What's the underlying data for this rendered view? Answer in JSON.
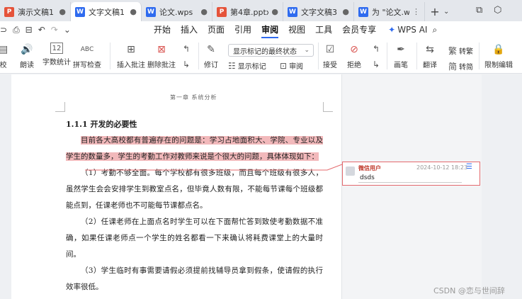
{
  "tabs": [
    {
      "label": "演示文稿1",
      "type": "ppt",
      "type_label": "P",
      "close": "●"
    },
    {
      "label": "文字文稿1",
      "type": "wps",
      "type_label": "W",
      "close": "●",
      "active": true
    },
    {
      "label": "论文.wps",
      "type": "wps",
      "type_label": "W",
      "close": "●"
    },
    {
      "label": "第4章.pptx",
      "type": "ppt",
      "type_label": "P",
      "close": "●"
    },
    {
      "label": "文字文稿3",
      "type": "wps",
      "type_label": "W",
      "close": "●"
    },
    {
      "label": "为 \"论文.wps\"",
      "type": "wps",
      "type_label": "W",
      "close": "⋮"
    }
  ],
  "tabbar": {
    "plus": "+",
    "chevron": "⌄",
    "restore": "⧉",
    "cube": "⬡"
  },
  "quick_access": {
    "link": "⊃",
    "print": "⎙",
    "print_preview": "⊟",
    "undo": "↶",
    "redo": "↷",
    "more": "⌄"
  },
  "menus": [
    "开始",
    "插入",
    "页面",
    "引用",
    "审阅",
    "视图",
    "工具",
    "会员专享"
  ],
  "active_menu": "审阅",
  "wps_ai": {
    "label": "WPS AI",
    "icon": "✦",
    "search": "⌕"
  },
  "ribbon": {
    "proof": "校",
    "read_aloud": "朗读",
    "word_count": "字数统计",
    "word_count_icon": "12",
    "spell_check": "拼写检查",
    "spell_icon": "ABC",
    "insert_comment": "插入批注",
    "delete_comment": "删除批注",
    "revise": "修订",
    "show_markup_state": "显示标记的最终状态",
    "show_markup": "显示标记",
    "review": "审阅",
    "accept": "接受",
    "reject": "拒绝",
    "pen": "画笔",
    "translate": "翻译",
    "to_traditional": "转繁",
    "to_simplified": "转简",
    "restrict_edit": "限制编辑",
    "dd_arrow": "⌄"
  },
  "document": {
    "running_header": "第一章   系统分析",
    "heading": "1.1.1   开发的必要性",
    "para_highlight": "目前各大高校都有普遍存在的问题是：学习占地面积大、学院、专业以及学生的数量多，学生的考勤工作对教师来说是个很大的问题，具体体现如下：",
    "para1": "（1）考勤不够全面。每个学校都有很多班级，而且每个班级有很多人，虽然学生会会安排学生到教室点名，但毕竟人数有限，不能每节课每个班级都能点到，任课老师也不可能每节课都点名。",
    "para2": "（2）任课老师在上面点名时学生可以在下面帮忙答到致使考勤数据不准确，如果任课老师点一个学生的姓名都看一下来确认将耗费课堂上的大量时间。",
    "para3": "（3）学生临时有事需要请假必须提前找辅导员拿到假条，使请假的执行效率很低。"
  },
  "comment": {
    "author": "微信用户",
    "time": "2024-10-12 18:23",
    "body": "dsds",
    "menu_icon": "☰"
  },
  "watermark": "CSDN @恋与世间辞",
  "colors": {
    "accent": "#2f6bef",
    "highlight": "#f2b9bb",
    "comment_border": "#e46a6e"
  }
}
